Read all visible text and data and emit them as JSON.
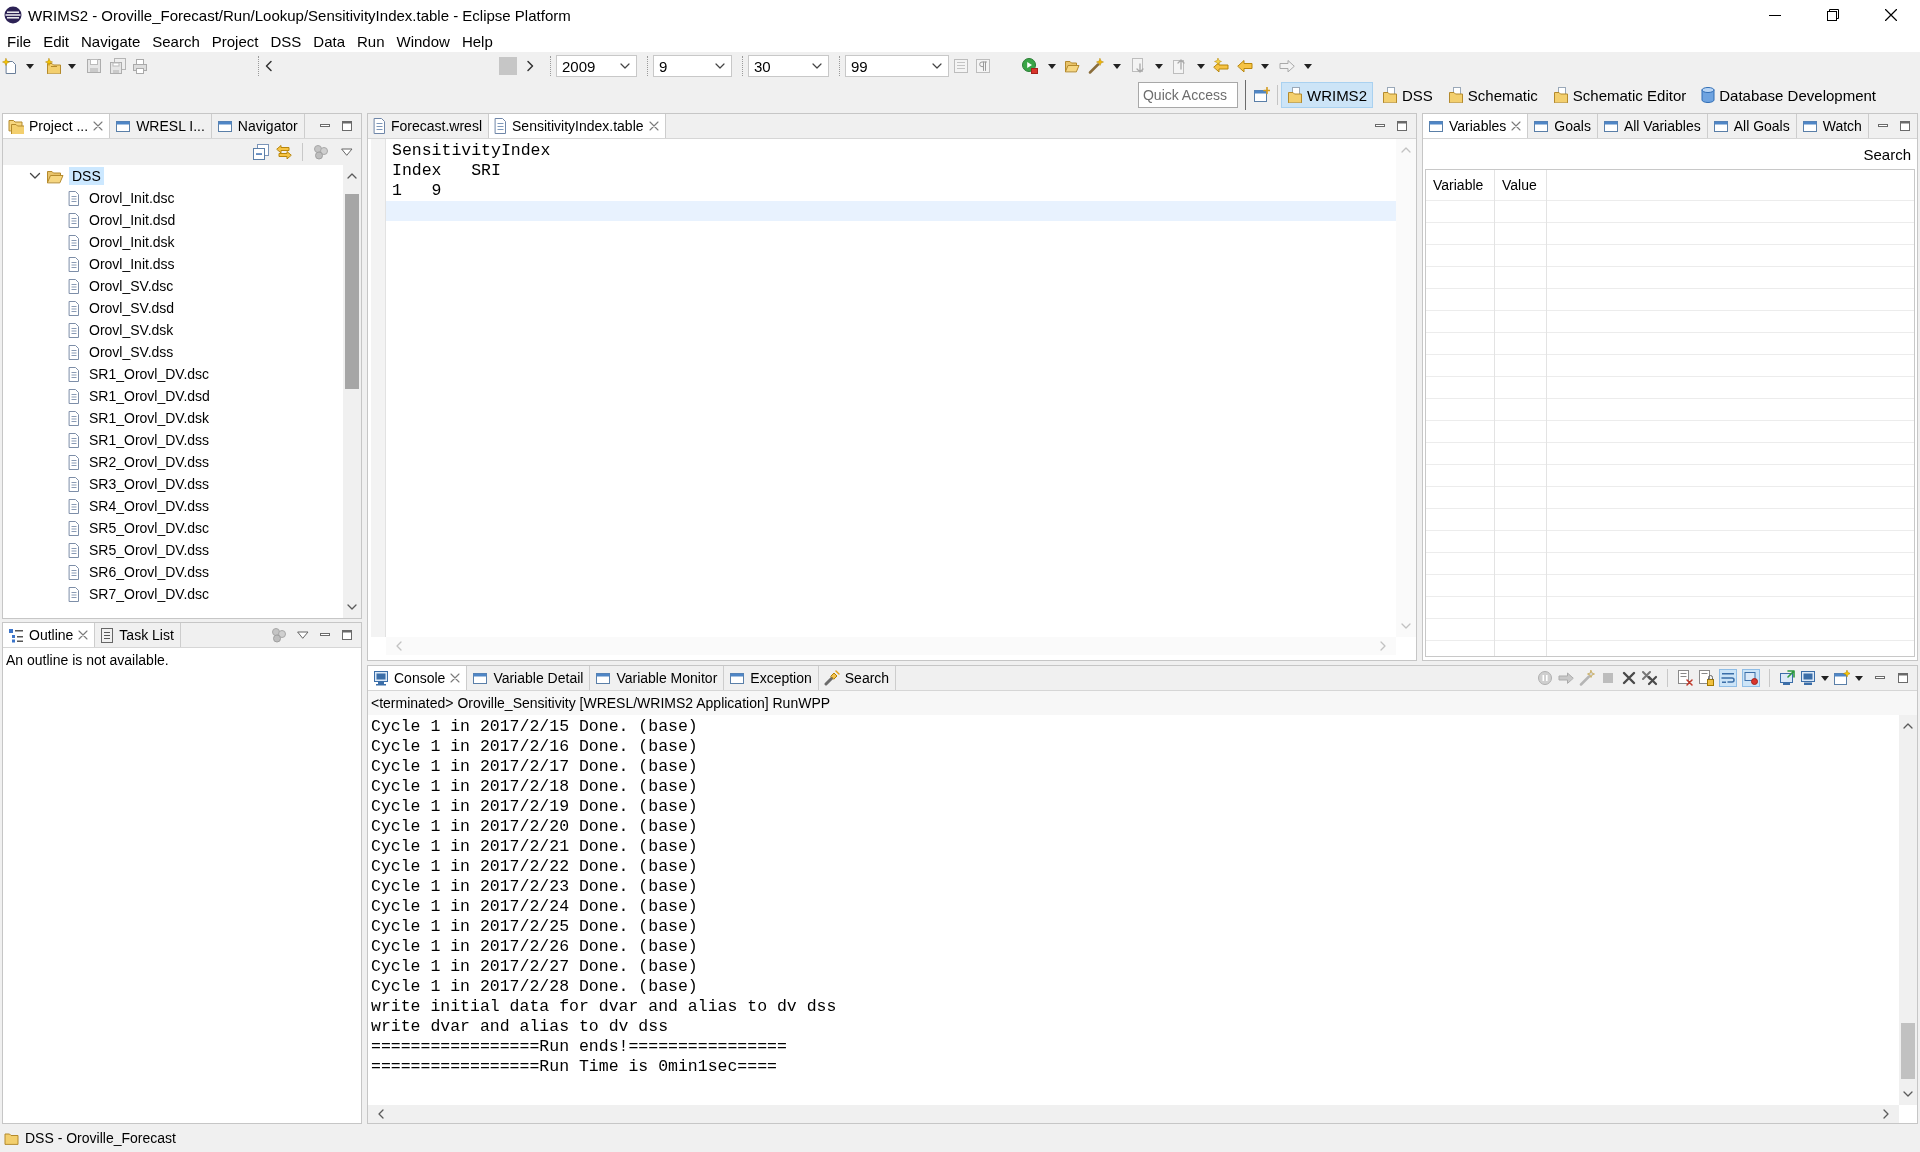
{
  "window": {
    "title": "WRIMS2 - Oroville_Forecast/Run/Lookup/SensitivityIndex.table - Eclipse Platform"
  },
  "menu_bar": [
    "File",
    "Edit",
    "Navigate",
    "Search",
    "Project",
    "DSS",
    "Data",
    "Run",
    "Window",
    "Help"
  ],
  "toolbar": {
    "combos": [
      {
        "value": "2009"
      },
      {
        "value": "9"
      },
      {
        "value": "30"
      },
      {
        "value": "99"
      }
    ]
  },
  "quick_access": {
    "placeholder": "Quick Access"
  },
  "perspectives": [
    {
      "label": "WRIMS2",
      "kind": "folder",
      "selected": true
    },
    {
      "label": "DSS",
      "kind": "folder",
      "selected": false
    },
    {
      "label": "Schematic",
      "kind": "folder",
      "selected": false
    },
    {
      "label": "Schematic Editor",
      "kind": "folder",
      "selected": false
    },
    {
      "label": "Database Development",
      "kind": "database",
      "selected": false
    }
  ],
  "project_explorer": {
    "tabs": [
      {
        "label": "Project ...",
        "kind": "project",
        "selected": true
      },
      {
        "label": "WRESL I...",
        "kind": "view",
        "selected": false
      },
      {
        "label": "Navigator",
        "kind": "view",
        "selected": false
      }
    ],
    "tree": [
      {
        "label": "DSS",
        "expanded": true,
        "selected": true,
        "children": [
          {
            "label": "Orovl_Init.dsc",
            "selected": false
          },
          {
            "label": "Orovl_Init.dsd",
            "selected": false
          },
          {
            "label": "Orovl_Init.dsk",
            "selected": false
          },
          {
            "label": "Orovl_Init.dss",
            "selected": false
          },
          {
            "label": "Orovl_SV.dsc",
            "selected": false
          },
          {
            "label": "Orovl_SV.dsd",
            "selected": false
          },
          {
            "label": "Orovl_SV.dsk",
            "selected": false
          },
          {
            "label": "Orovl_SV.dss",
            "selected": false
          },
          {
            "label": "SR1_Orovl_DV.dsc",
            "selected": false
          },
          {
            "label": "SR1_Orovl_DV.dsd",
            "selected": false
          },
          {
            "label": "SR1_Orovl_DV.dsk",
            "selected": false
          },
          {
            "label": "SR1_Orovl_DV.dss",
            "selected": false
          },
          {
            "label": "SR2_Orovl_DV.dss",
            "selected": false
          },
          {
            "label": "SR3_Orovl_DV.dss",
            "selected": false
          },
          {
            "label": "SR4_Orovl_DV.dss",
            "selected": false
          },
          {
            "label": "SR5_Orovl_DV.dsc",
            "selected": false
          },
          {
            "label": "SR5_Orovl_DV.dss",
            "selected": false
          },
          {
            "label": "SR6_Orovl_DV.dss",
            "selected": false
          },
          {
            "label": "SR7_Orovl_DV.dsc",
            "selected": false
          }
        ]
      }
    ]
  },
  "outline": {
    "tabs": [
      {
        "label": "Outline",
        "kind": "outline",
        "selected": true
      },
      {
        "label": "Task List",
        "kind": "tasks",
        "selected": false
      }
    ],
    "message": "An outline is not available."
  },
  "editor": {
    "tabs": [
      {
        "label": "Forecast.wresl",
        "kind": "file",
        "selected": false
      },
      {
        "label": "SensitivityIndex.table",
        "kind": "file",
        "selected": true
      }
    ],
    "lines": [
      {
        "text": "SensitivityIndex",
        "current": false
      },
      {
        "text": "Index   SRI",
        "current": false
      },
      {
        "text": "1   9",
        "current": false
      },
      {
        "current": true
      }
    ]
  },
  "variables": {
    "tabs": [
      {
        "label": "Variables",
        "kind": "view",
        "selected": true
      },
      {
        "label": "Goals",
        "kind": "view",
        "selected": false
      },
      {
        "label": "All Variables",
        "kind": "view",
        "selected": false
      },
      {
        "label": "All Goals",
        "kind": "view",
        "selected": false
      },
      {
        "label": "Watch",
        "kind": "view",
        "selected": false
      }
    ],
    "search_button": "Search",
    "columns": [
      "Variable",
      "Value"
    ]
  },
  "console": {
    "tabs": [
      {
        "label": "Console",
        "kind": "console",
        "selected": true
      },
      {
        "label": "Variable Detail",
        "kind": "view",
        "selected": false
      },
      {
        "label": "Variable Monitor",
        "kind": "view",
        "selected": false
      },
      {
        "label": "Exception",
        "kind": "view",
        "selected": false
      },
      {
        "label": "Search",
        "kind": "search",
        "selected": false
      }
    ],
    "description": "<terminated> Oroville_Sensitivity [WRESL/WRIMS2 Application] RunWPP",
    "lines": [
      "Cycle 1 in 2017/2/15 Done. (base)",
      "Cycle 1 in 2017/2/16 Done. (base)",
      "Cycle 1 in 2017/2/17 Done. (base)",
      "Cycle 1 in 2017/2/18 Done. (base)",
      "Cycle 1 in 2017/2/19 Done. (base)",
      "Cycle 1 in 2017/2/20 Done. (base)",
      "Cycle 1 in 2017/2/21 Done. (base)",
      "Cycle 1 in 2017/2/22 Done. (base)",
      "Cycle 1 in 2017/2/23 Done. (base)",
      "Cycle 1 in 2017/2/24 Done. (base)",
      "Cycle 1 in 2017/2/25 Done. (base)",
      "Cycle 1 in 2017/2/26 Done. (base)",
      "Cycle 1 in 2017/2/27 Done. (base)",
      "Cycle 1 in 2017/2/28 Done. (base)",
      "write initial data for dvar and alias to dv dss",
      "write dvar and alias to dv dss",
      "=================Run ends!================",
      "=================Run Time is 0min1sec===="
    ]
  },
  "status_bar": {
    "text": "DSS - Oroville_Forecast"
  }
}
